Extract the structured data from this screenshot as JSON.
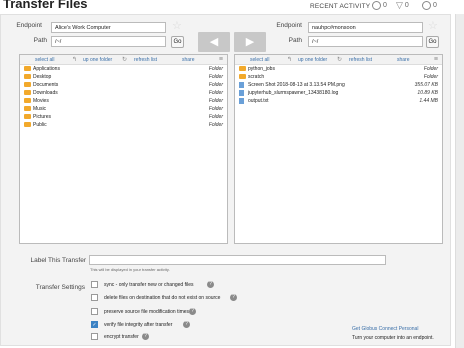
{
  "page_title": "Transfer Files",
  "recent_activity": {
    "label": "RECENT ACTIVITY",
    "active": "0",
    "failed": "0",
    "succeeded": "0"
  },
  "left": {
    "endpoint_label": "Endpoint",
    "endpoint_value": "Alice's Work Computer",
    "path_label": "Path",
    "path_value": "/~/",
    "go_label": "Go",
    "toolbar": {
      "select_all": "select all",
      "up_one_folder": "up one folder",
      "refresh_list": "refresh list",
      "share": "share"
    },
    "files": [
      {
        "name": "Applications",
        "kind": "folder",
        "size": "Folder"
      },
      {
        "name": "Desktop",
        "kind": "folder",
        "size": "Folder"
      },
      {
        "name": "Documents",
        "kind": "folder",
        "size": "Folder"
      },
      {
        "name": "Downloads",
        "kind": "folder",
        "size": "Folder"
      },
      {
        "name": "Movies",
        "kind": "folder",
        "size": "Folder"
      },
      {
        "name": "Music",
        "kind": "folder",
        "size": "Folder"
      },
      {
        "name": "Pictures",
        "kind": "folder",
        "size": "Folder"
      },
      {
        "name": "Public",
        "kind": "folder",
        "size": "Folder"
      }
    ]
  },
  "right": {
    "endpoint_label": "Endpoint",
    "endpoint_value": "nauhpc#monsoon",
    "path_label": "Path",
    "path_value": "/~/",
    "go_label": "Go",
    "toolbar": {
      "select_all": "select all",
      "up_one_folder": "up one folder",
      "refresh_list": "refresh list",
      "share": "share"
    },
    "files": [
      {
        "name": "python_jobs",
        "kind": "folder",
        "size": "Folder"
      },
      {
        "name": "scratch",
        "kind": "folder",
        "size": "Folder"
      },
      {
        "name": "Screen Shot 2018-08-13 at 3.13.54 PM.png",
        "kind": "file",
        "size": "355.07 KB"
      },
      {
        "name": "jupyterhub_slurmspawner_13438180.log",
        "kind": "file",
        "size": "10.89 KB"
      },
      {
        "name": "output.txt",
        "kind": "file",
        "size": "1.44 MB"
      }
    ]
  },
  "transfer_label": {
    "label": "Label This Transfer",
    "value": "",
    "hint": "This will be displayed in your transfer activity."
  },
  "settings": {
    "label": "Transfer Settings",
    "options": [
      {
        "label": "sync - only transfer new or changed files",
        "checked": false
      },
      {
        "label": "delete files on destination that do not exist on source",
        "checked": false
      },
      {
        "label": "preserve source file modification times",
        "checked": false
      },
      {
        "label": "verify file integrity after transfer",
        "checked": true
      },
      {
        "label": "encrypt transfer",
        "checked": false
      }
    ]
  },
  "gcp": {
    "link": "Get Globus Connect Personal",
    "sub": "Turn your computer into an endpoint."
  },
  "icons": {
    "active": "circle-icon",
    "failed": "triangle-down-icon",
    "succeeded": "circle-icon",
    "bookmark": "star-icon",
    "help": "question-icon",
    "folder": "folder-icon",
    "file": "file-icon"
  },
  "colors": {
    "folder": "#f2a92b",
    "file": "#6aa0d8",
    "link": "#3a6fa8",
    "checked": "#3b82c4"
  }
}
